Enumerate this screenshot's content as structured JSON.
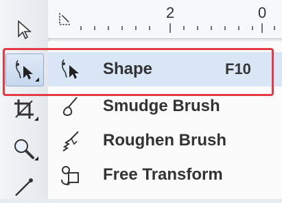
{
  "ruler": {
    "labels": [
      "2",
      "0"
    ]
  },
  "toolbox": {
    "tools": [
      {
        "name": "pick-tool-icon"
      },
      {
        "name": "shape-tool-icon"
      },
      {
        "name": "crop-tool-icon"
      },
      {
        "name": "zoom-tool-icon"
      },
      {
        "name": "freehand-tool-icon"
      }
    ]
  },
  "menu": {
    "items": [
      {
        "label": "Shape",
        "shortcut": "F10",
        "icon": "shape-icon"
      },
      {
        "label": "Smudge Brush",
        "shortcut": "",
        "icon": "smudge-brush-icon"
      },
      {
        "label": "Roughen Brush",
        "shortcut": "",
        "icon": "roughen-brush-icon"
      },
      {
        "label": "Free Transform",
        "shortcut": "",
        "icon": "free-transform-icon"
      }
    ]
  },
  "colors": {
    "highlight": "#e53945",
    "selected_bg": "#d8e6f6"
  }
}
